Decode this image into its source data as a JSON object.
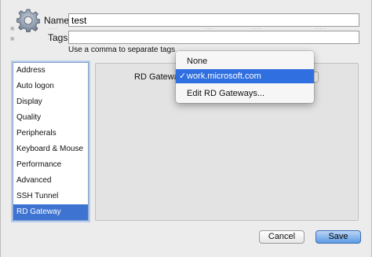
{
  "form": {
    "name_label": "Name:",
    "name_value": "test",
    "tags_label": "Tags:",
    "tags_value": "",
    "tags_hint": "Use a comma to separate tags"
  },
  "sidebar": {
    "items": [
      {
        "label": "Address"
      },
      {
        "label": "Auto logon"
      },
      {
        "label": "Display"
      },
      {
        "label": "Quality"
      },
      {
        "label": "Peripherals"
      },
      {
        "label": "Keyboard & Mouse"
      },
      {
        "label": "Performance"
      },
      {
        "label": "Advanced"
      },
      {
        "label": "SSH Tunnel"
      },
      {
        "label": "RD Gateway"
      }
    ],
    "selected": "RD Gateway"
  },
  "panel": {
    "gateway_label": "RD Gateway"
  },
  "menu": {
    "items": [
      {
        "label": "None"
      },
      {
        "label": "work.microsoft.com",
        "checked": "✓"
      },
      {
        "label": "Edit RD Gateways..."
      }
    ]
  },
  "buttons": {
    "cancel": "Cancel",
    "save": "Save"
  },
  "colors": {
    "selection": "#3e73d1",
    "menu_highlight": "#2f6fe0",
    "primary_button": "#5d9ae3"
  }
}
